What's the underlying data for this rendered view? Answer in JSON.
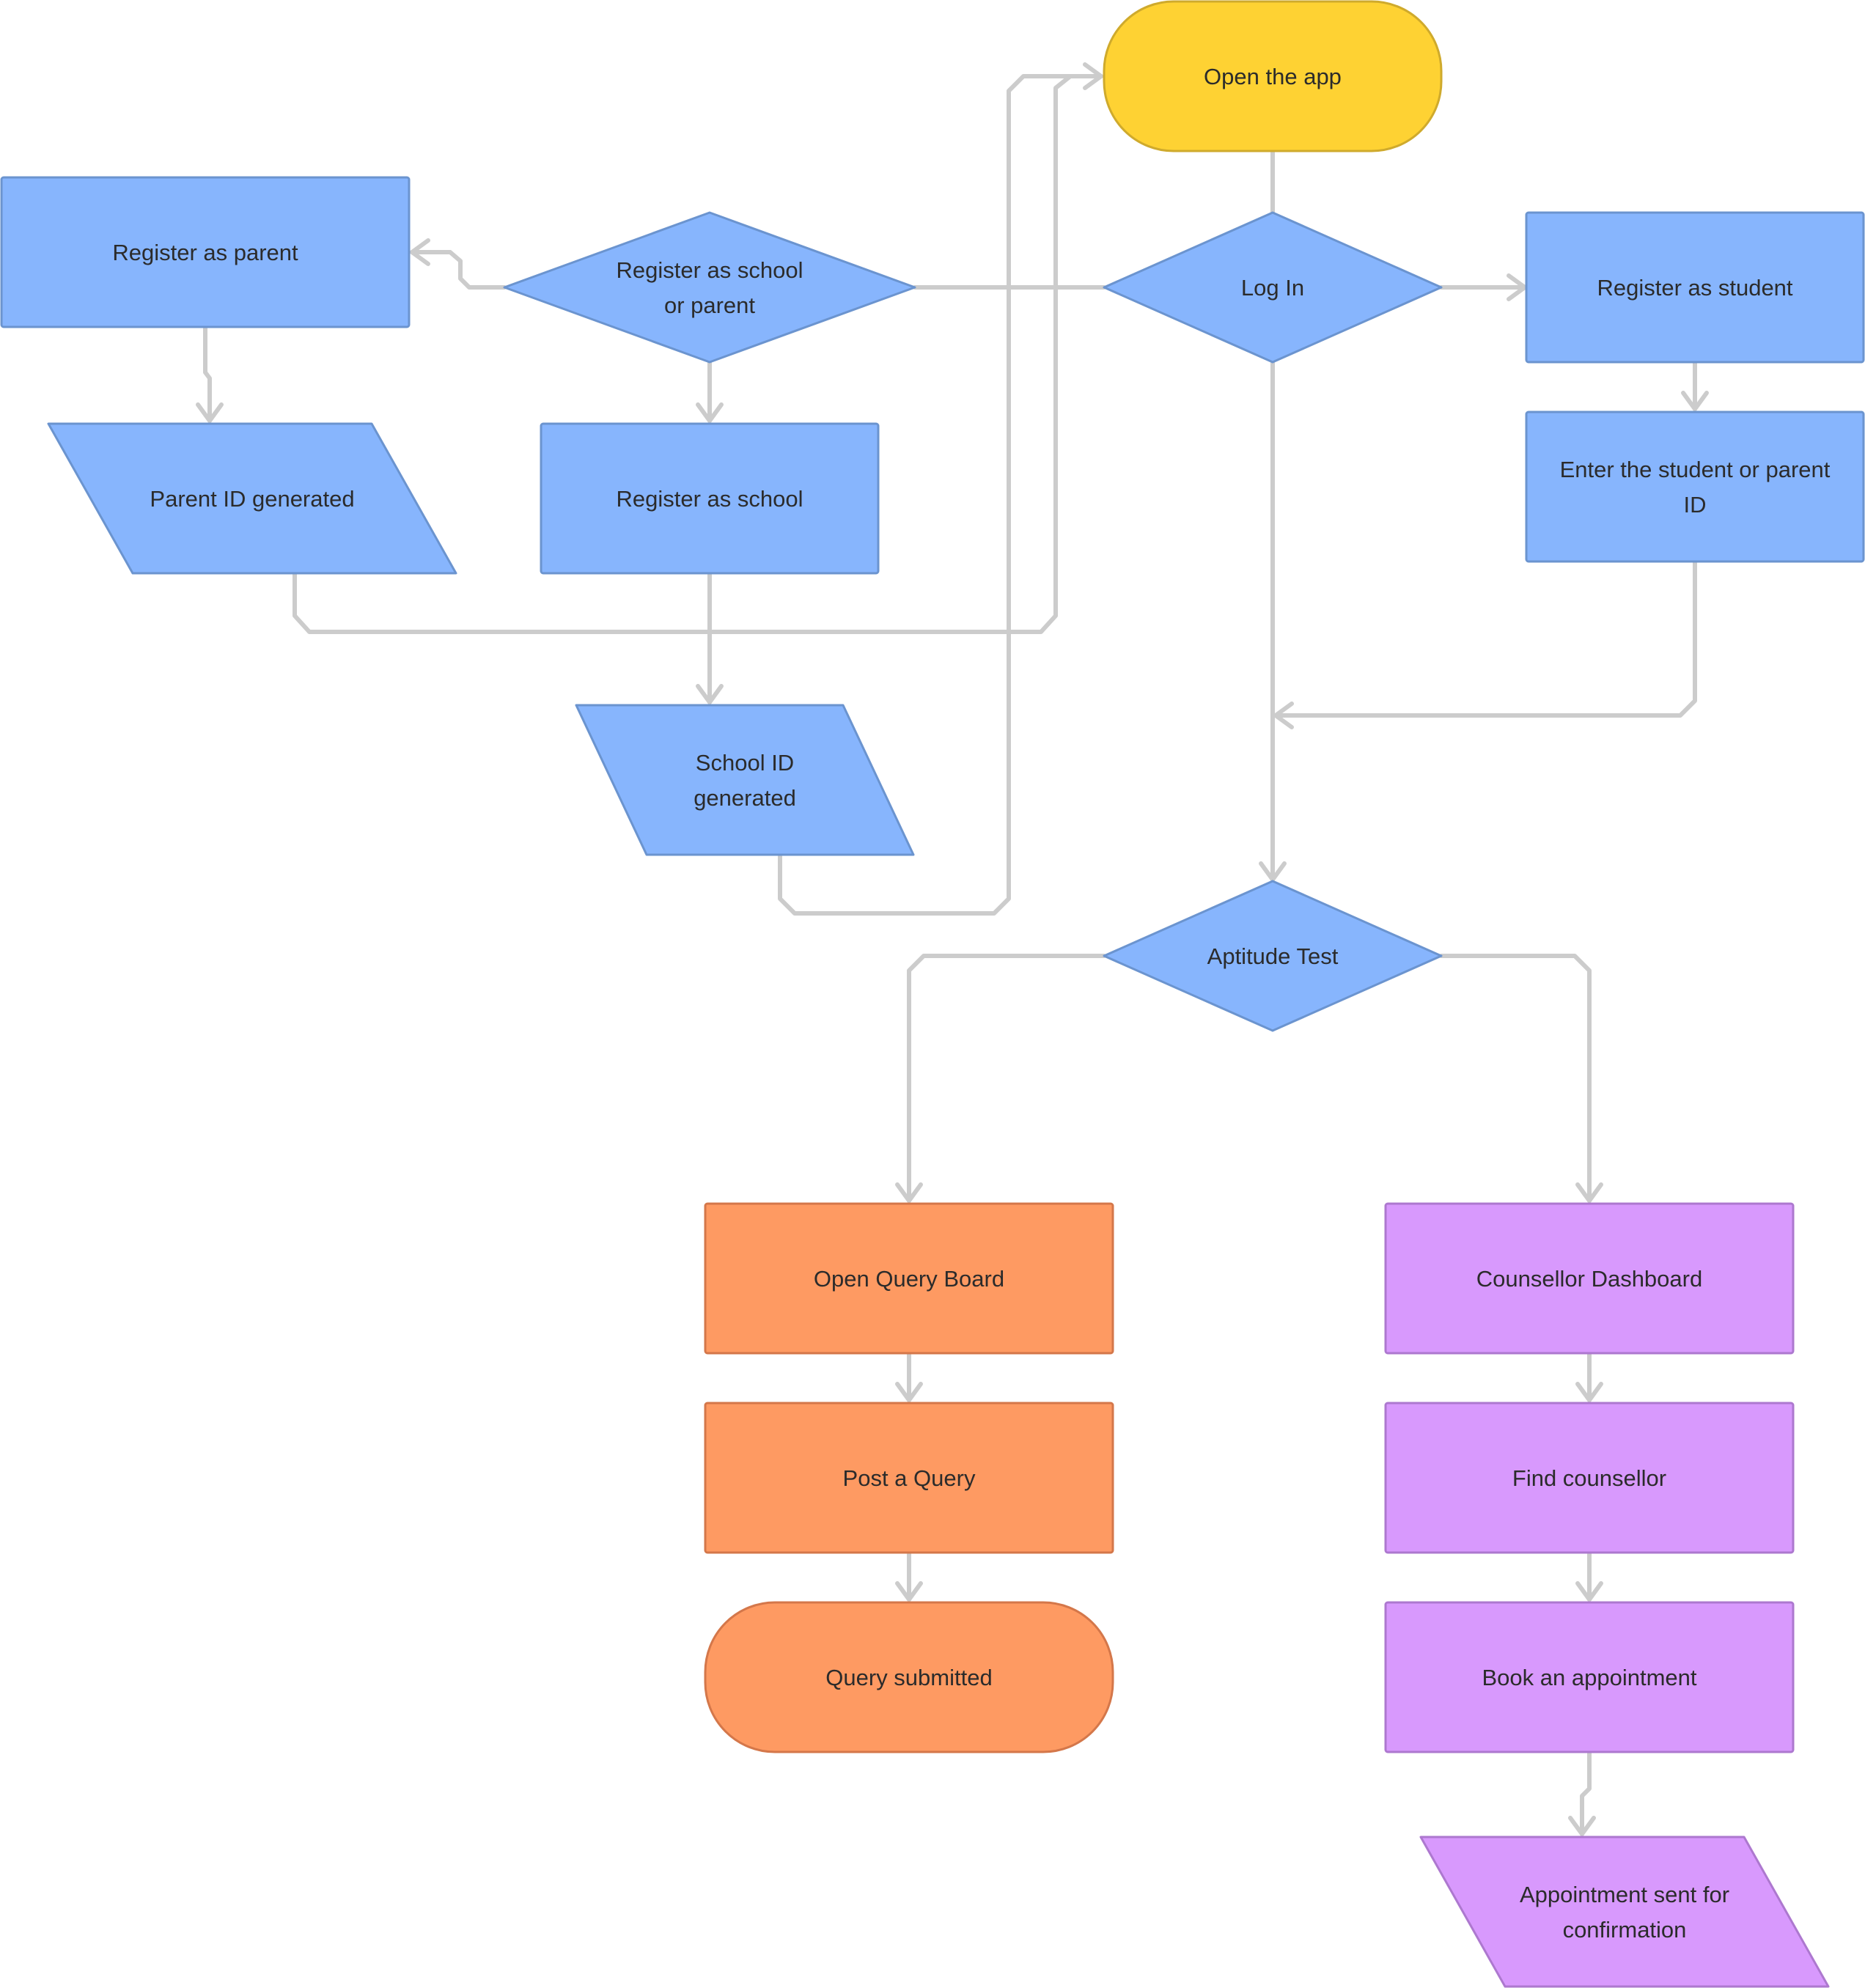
{
  "diagram": {
    "type": "flowchart",
    "colors": {
      "start_fill": "#fed233",
      "start_stroke": "#cfaa2c",
      "blue_fill": "#87b5fd",
      "blue_stroke": "#6b94cf",
      "orange_fill": "#fe9a62",
      "orange_stroke": "#d4774a",
      "purple_fill": "#d899fd",
      "purple_stroke": "#ad78cf",
      "edge": "#cccccc",
      "text": "#2b2b2b"
    },
    "nodes": [
      {
        "id": "open_app",
        "label": [
          "Open the app"
        ],
        "shape": "terminal",
        "color": "start"
      },
      {
        "id": "login",
        "label": [
          "Log In"
        ],
        "shape": "decision",
        "color": "blue"
      },
      {
        "id": "reg_school_or_parent",
        "label": [
          "Register as school",
          "or parent"
        ],
        "shape": "decision",
        "color": "blue"
      },
      {
        "id": "reg_parent",
        "label": [
          "Register as parent"
        ],
        "shape": "process",
        "color": "blue"
      },
      {
        "id": "parent_id",
        "label": [
          "Parent ID generated"
        ],
        "shape": "data",
        "color": "blue"
      },
      {
        "id": "reg_school",
        "label": [
          "Register as school"
        ],
        "shape": "process",
        "color": "blue"
      },
      {
        "id": "school_id",
        "label": [
          "School ID",
          "generated"
        ],
        "shape": "data",
        "color": "blue"
      },
      {
        "id": "reg_student",
        "label": [
          "Register as student"
        ],
        "shape": "process",
        "color": "blue"
      },
      {
        "id": "enter_id",
        "label": [
          "Enter the student or parent",
          "ID"
        ],
        "shape": "process",
        "color": "blue"
      },
      {
        "id": "aptitude",
        "label": [
          "Aptitude Test"
        ],
        "shape": "decision",
        "color": "blue"
      },
      {
        "id": "query_board",
        "label": [
          "Open Query Board"
        ],
        "shape": "process",
        "color": "orange"
      },
      {
        "id": "post_query",
        "label": [
          "Post a Query"
        ],
        "shape": "process",
        "color": "orange"
      },
      {
        "id": "query_submitted",
        "label": [
          "Query submitted"
        ],
        "shape": "terminal",
        "color": "orange"
      },
      {
        "id": "counsellor_dashboard",
        "label": [
          "Counsellor Dashboard"
        ],
        "shape": "process",
        "color": "purple"
      },
      {
        "id": "find_counsellor",
        "label": [
          "Find counsellor"
        ],
        "shape": "process",
        "color": "purple"
      },
      {
        "id": "book_appointment",
        "label": [
          "Book an appointment"
        ],
        "shape": "process",
        "color": "purple"
      },
      {
        "id": "appointment_sent",
        "label": [
          "Appointment sent for",
          "confirmation"
        ],
        "shape": "data",
        "color": "purple"
      }
    ],
    "edges": [
      {
        "from": "open_app",
        "to": "login"
      },
      {
        "from": "login",
        "to": "reg_school_or_parent"
      },
      {
        "from": "login",
        "to": "reg_student"
      },
      {
        "from": "login",
        "to": "aptitude"
      },
      {
        "from": "reg_school_or_parent",
        "to": "reg_parent"
      },
      {
        "from": "reg_school_or_parent",
        "to": "reg_school"
      },
      {
        "from": "reg_parent",
        "to": "parent_id"
      },
      {
        "from": "reg_school",
        "to": "school_id"
      },
      {
        "from": "parent_id",
        "to": "open_app"
      },
      {
        "from": "school_id",
        "to": "open_app"
      },
      {
        "from": "reg_student",
        "to": "enter_id"
      },
      {
        "from": "enter_id",
        "to": "aptitude"
      },
      {
        "from": "aptitude",
        "to": "query_board"
      },
      {
        "from": "aptitude",
        "to": "counsellor_dashboard"
      },
      {
        "from": "query_board",
        "to": "post_query"
      },
      {
        "from": "post_query",
        "to": "query_submitted"
      },
      {
        "from": "counsellor_dashboard",
        "to": "find_counsellor"
      },
      {
        "from": "find_counsellor",
        "to": "book_appointment"
      },
      {
        "from": "book_appointment",
        "to": "appointment_sent"
      }
    ]
  }
}
